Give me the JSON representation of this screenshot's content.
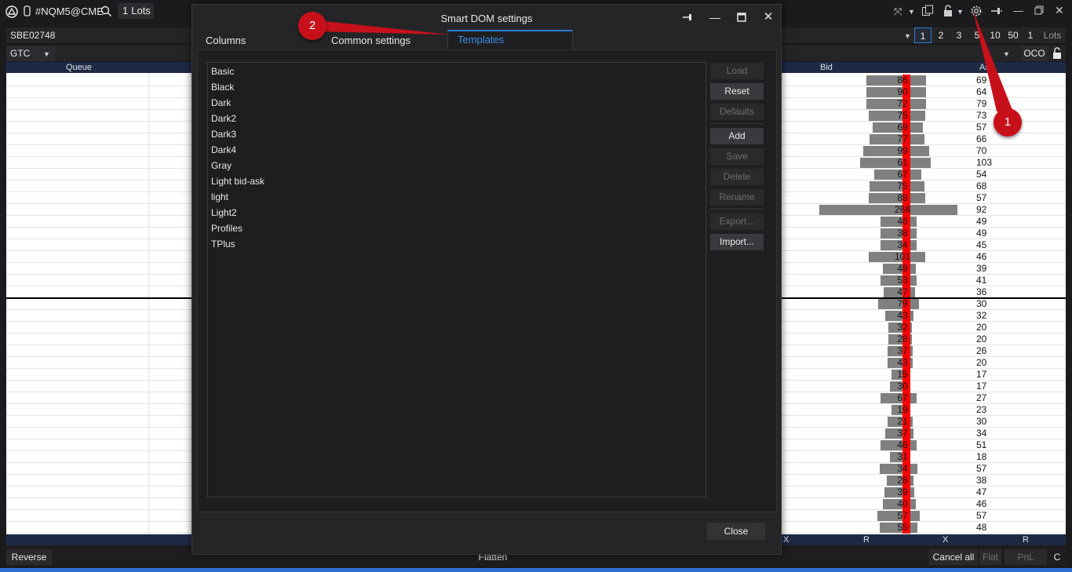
{
  "topbar": {
    "symbol": "#NQM5@CME",
    "lots_value": "1",
    "lots_label": "Lots",
    "icons": [
      "app-logo-icon",
      "phone-icon",
      "search-icon",
      "pin-x-icon",
      "chevron-down-icon",
      "copy-icon",
      "lock-icon",
      "gear-icon",
      "pin-icon",
      "minimize-icon",
      "restore-icon",
      "close-icon"
    ]
  },
  "account": {
    "name": "SBE02748"
  },
  "order": {
    "tif": "GTC",
    "oco_label": "OCO"
  },
  "quantities": [
    "1",
    "2",
    "3",
    "5",
    "10",
    "50",
    "1",
    "Lots"
  ],
  "dom": {
    "headers": {
      "queue": "Queue",
      "bid": "Bid",
      "ask": "As"
    },
    "footer_headers": [
      "X",
      "R",
      "X",
      "R"
    ],
    "rows": [
      {
        "bid": "86",
        "bw": 76,
        "ask": "69"
      },
      {
        "bid": "90",
        "bw": 76,
        "ask": "64"
      },
      {
        "bid": "72",
        "bw": 76,
        "ask": "79"
      },
      {
        "bid": "75",
        "bw": 72,
        "ask": "73"
      },
      {
        "bid": "69",
        "bw": 64,
        "ask": "57"
      },
      {
        "bid": "77",
        "bw": 70,
        "ask": "66"
      },
      {
        "bid": "99",
        "bw": 84,
        "ask": "70"
      },
      {
        "bid": "61",
        "bw": 90,
        "ask": "103"
      },
      {
        "bid": "67",
        "bw": 60,
        "ask": "54"
      },
      {
        "bid": "75",
        "bw": 70,
        "ask": "68"
      },
      {
        "bid": "88",
        "bw": 72,
        "ask": "57"
      },
      {
        "bid": "268",
        "bw": 176,
        "ask": "92"
      },
      {
        "bid": "46",
        "bw": 46,
        "ask": "49"
      },
      {
        "bid": "38",
        "bw": 46,
        "ask": "49"
      },
      {
        "bid": "34",
        "bw": 46,
        "ask": "45"
      },
      {
        "bid": "101",
        "bw": 72,
        "ask": "46"
      },
      {
        "bid": "48",
        "bw": 42,
        "ask": "39"
      },
      {
        "bid": "53",
        "bw": 46,
        "ask": "41"
      },
      {
        "bid": "47",
        "bw": 40,
        "ask": "36"
      },
      {
        "bid": "79",
        "bw": 52,
        "ask": "30"
      },
      {
        "bid": "43",
        "bw": 36,
        "ask": "32"
      },
      {
        "bid": "32",
        "bw": 30,
        "ask": "20"
      },
      {
        "bid": "28",
        "bw": 30,
        "ask": "20"
      },
      {
        "bid": "37",
        "bw": 32,
        "ask": "26"
      },
      {
        "bid": "43",
        "bw": 32,
        "ask": "20"
      },
      {
        "bid": "15",
        "bw": 24,
        "ask": "17"
      },
      {
        "bid": "30",
        "bw": 26,
        "ask": "17"
      },
      {
        "bid": "67",
        "bw": 46,
        "ask": "27"
      },
      {
        "bid": "19",
        "bw": 24,
        "ask": "23"
      },
      {
        "bid": "21",
        "bw": 32,
        "ask": "30"
      },
      {
        "bid": "37",
        "bw": 36,
        "ask": "34"
      },
      {
        "bid": "46",
        "bw": 46,
        "ask": "51"
      },
      {
        "bid": "31",
        "bw": 26,
        "ask": "18"
      },
      {
        "bid": "34",
        "bw": 48,
        "ask": "57"
      },
      {
        "bid": "28",
        "bw": 34,
        "ask": "38"
      },
      {
        "bid": "39",
        "bw": 38,
        "ask": "47"
      },
      {
        "bid": "40",
        "bw": 42,
        "ask": "46"
      },
      {
        "bid": "57",
        "bw": 54,
        "ask": "57"
      },
      {
        "bid": "55",
        "bw": 48,
        "ask": "48"
      }
    ]
  },
  "footer": {
    "reverse": "Reverse",
    "flatten": "Flatten",
    "cancel_all": "Cancel all",
    "flat": "Flat",
    "pnl": "PnL",
    "c": "C"
  },
  "dialog": {
    "title": "Smart DOM settings",
    "tabs": [
      "Columns",
      "Common settings",
      "Templates"
    ],
    "active_tab": "Templates",
    "templates": [
      "Basic",
      "Black",
      "Dark",
      "Dark2",
      "Dark3",
      "Dark4",
      "Gray",
      "Light bid-ask",
      "light",
      "Light2",
      "Profiles",
      "TPlus"
    ],
    "buttons": {
      "load": "Load",
      "reset": "Reset",
      "defaults": "Defaults",
      "add": "Add",
      "save": "Save",
      "delete": "Delete",
      "rename": "Rename",
      "export": "Export...",
      "import": "Import...",
      "close": "Close"
    }
  },
  "annotations": {
    "one": "1",
    "two": "2",
    "color": "#c8101a"
  }
}
